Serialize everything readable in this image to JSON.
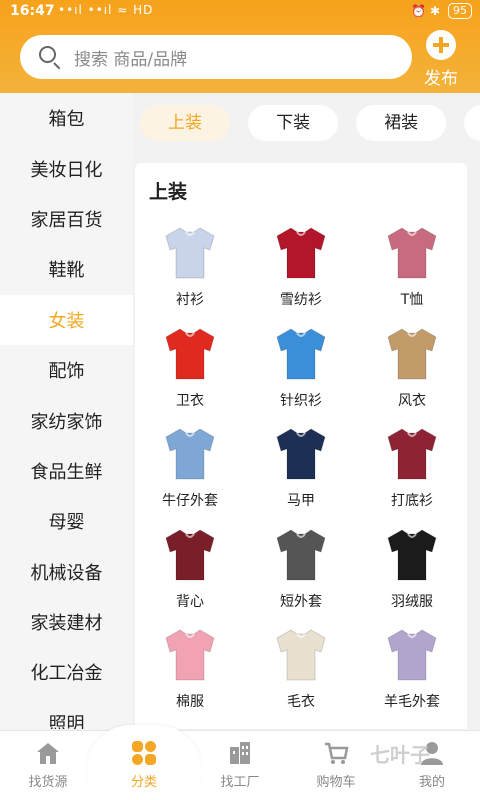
{
  "status": {
    "time": "16:47",
    "signals": "••ıl ••ıl ≈ HD",
    "icons": "⏰ ✱",
    "battery": "95"
  },
  "search": {
    "placeholder": "搜索 商品/品牌"
  },
  "publish": {
    "label": "发布"
  },
  "sidebar": {
    "items": [
      {
        "label": "箱包"
      },
      {
        "label": "美妆日化"
      },
      {
        "label": "家居百货"
      },
      {
        "label": "鞋靴"
      },
      {
        "label": "女装",
        "active": true
      },
      {
        "label": "配饰"
      },
      {
        "label": "家纺家饰"
      },
      {
        "label": "食品生鲜"
      },
      {
        "label": "母婴"
      },
      {
        "label": "机械设备"
      },
      {
        "label": "家装建材"
      },
      {
        "label": "化工冶金"
      },
      {
        "label": "照明"
      }
    ]
  },
  "tabs": [
    {
      "label": "上装",
      "active": true
    },
    {
      "label": "下装"
    },
    {
      "label": "裙装"
    },
    {
      "label": "□"
    }
  ],
  "section": {
    "title": "上装",
    "items": [
      {
        "label": "衬衫",
        "color": "#c9d4ea"
      },
      {
        "label": "雪纺衫",
        "color": "#b3152a"
      },
      {
        "label": "T恤",
        "color": "#c96b7e"
      },
      {
        "label": "卫衣",
        "color": "#e12a1f"
      },
      {
        "label": "针织衫",
        "color": "#3b8ed8"
      },
      {
        "label": "风衣",
        "color": "#c39b6b"
      },
      {
        "label": "牛仔外套",
        "color": "#7ea7d6"
      },
      {
        "label": "马甲",
        "color": "#1d2f55"
      },
      {
        "label": "打底衫",
        "color": "#8e2335"
      },
      {
        "label": "背心",
        "color": "#7a1e2a"
      },
      {
        "label": "短外套",
        "color": "#555555"
      },
      {
        "label": "羽绒服",
        "color": "#1b1b1b"
      },
      {
        "label": "棉服",
        "color": "#f1a3b3"
      },
      {
        "label": "毛衣",
        "color": "#e9e1d0"
      },
      {
        "label": "羊毛外套",
        "color": "#b2a6cf"
      }
    ]
  },
  "tabbar": {
    "items": [
      {
        "label": "找货源",
        "icon": "home-icon"
      },
      {
        "label": "分类",
        "icon": "category-icon",
        "active": true
      },
      {
        "label": "找工厂",
        "icon": "factory-icon"
      },
      {
        "label": "购物车",
        "icon": "cart-icon"
      },
      {
        "label": "我的",
        "icon": "user-icon"
      }
    ],
    "watermark": "七叶子"
  },
  "colors": {
    "accent": "#f3a724",
    "header": "#f7a21b"
  }
}
